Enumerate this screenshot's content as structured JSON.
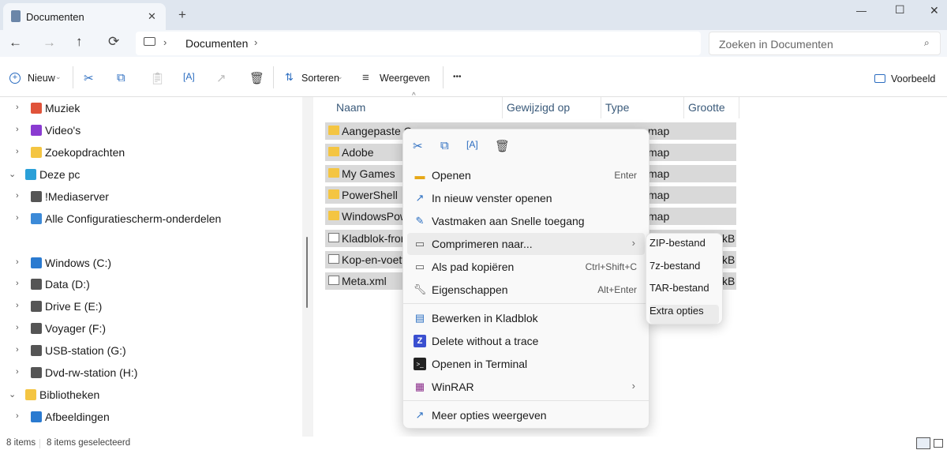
{
  "tab": {
    "title": "Documenten",
    "close": "✕",
    "new": "+"
  },
  "window": {
    "minimize": "—",
    "maximize": "☐",
    "close": "✕"
  },
  "nav": {
    "back": "←",
    "forward": "→",
    "up": "↑",
    "refresh": "⟳",
    "breadcrumb": [
      "Documenten"
    ],
    "search_placeholder": "Zoeken in Documenten"
  },
  "toolbar": {
    "new_label": "Nieuw",
    "sort_label": "Sorteren",
    "view_label": "Weergeven",
    "more": "•••",
    "preview_label": "Voorbeeld"
  },
  "sidebar": {
    "items": [
      {
        "label": "Muziek",
        "icon": "music-icon",
        "color": "#e0533a"
      },
      {
        "label": "Video's",
        "icon": "video-icon",
        "color": "#8a3bd1"
      },
      {
        "label": "Zoekopdrachten",
        "icon": "folder-icon",
        "color": "#f4c542"
      },
      {
        "label": "Deze pc",
        "icon": "monitor-icon",
        "color": "#2aa0d8"
      },
      {
        "label": "!Mediaserver",
        "icon": "network-drive-icon",
        "color": "#555"
      },
      {
        "label": "Alle Configuratiescherm-onderdelen",
        "icon": "control-panel-icon",
        "color": "#3c8ad8"
      },
      {
        "label": "Windows (C:)",
        "icon": "windows-drive-icon",
        "color": "#2a7ad0"
      },
      {
        "label": "Data (D:)",
        "icon": "drive-icon",
        "color": "#555"
      },
      {
        "label": "Drive E (E:)",
        "icon": "drive-icon",
        "color": "#555"
      },
      {
        "label": "Voyager (F:)",
        "icon": "drive-icon",
        "color": "#555"
      },
      {
        "label": "USB-station (G:)",
        "icon": "drive-icon",
        "color": "#555"
      },
      {
        "label": "Dvd-rw-station (H:)",
        "icon": "dvd-drive-icon",
        "color": "#555"
      },
      {
        "label": "Bibliotheken",
        "icon": "folder-icon",
        "color": "#f4c542"
      },
      {
        "label": "Afbeeldingen",
        "icon": "pictures-icon",
        "color": "#2a7ad0"
      }
    ]
  },
  "columns": {
    "name": "Naam",
    "modified": "Gewijzigd op",
    "type": "Type",
    "size": "Grootte"
  },
  "files": [
    {
      "name": "Aangepaste O",
      "type": "map",
      "size": "",
      "icon": "folder"
    },
    {
      "name": "Adobe",
      "type": "map",
      "size": "",
      "icon": "folder"
    },
    {
      "name": "My Games",
      "type": "map",
      "size": "",
      "icon": "folder"
    },
    {
      "name": "PowerShell",
      "type": "map",
      "size": "",
      "icon": "folder"
    },
    {
      "name": "WindowsPow",
      "type": "map",
      "size": "",
      "icon": "folder"
    },
    {
      "name": "Kladblok-fror",
      "type": "",
      "size": "kB",
      "icon": "doc"
    },
    {
      "name": "Kop-en-voett",
      "type": "",
      "size": "kB",
      "icon": "doc"
    },
    {
      "name": "Meta.xml",
      "type": "",
      "size": "kB",
      "icon": "file"
    }
  ],
  "context_menu": {
    "quick": [
      "cut-icon",
      "copy-icon",
      "rename-icon",
      "delete-icon"
    ],
    "items": [
      {
        "label": "Openen",
        "shortcut": "Enter",
        "icon": "open-folder-icon"
      },
      {
        "label": "In nieuw venster openen",
        "shortcut": "",
        "icon": "new-window-icon"
      },
      {
        "label": "Vastmaken aan Snelle toegang",
        "shortcut": "",
        "icon": "pin-icon"
      },
      {
        "label": "Comprimeren naar...",
        "shortcut": "",
        "icon": "zip-icon",
        "submenu": true
      },
      {
        "label": "Als pad kopiëren",
        "shortcut": "Ctrl+Shift+C",
        "icon": "copy-path-icon"
      },
      {
        "label": "Eigenschappen",
        "shortcut": "Alt+Enter",
        "icon": "wrench-icon"
      },
      {
        "label": "Bewerken in Kladblok",
        "shortcut": "",
        "icon": "notepad-icon"
      },
      {
        "label": "Delete without a trace",
        "shortcut": "",
        "icon": "shredder-icon"
      },
      {
        "label": "Openen in Terminal",
        "shortcut": "",
        "icon": "terminal-icon"
      },
      {
        "label": "WinRAR",
        "shortcut": "",
        "icon": "winrar-icon",
        "submenu": true
      },
      {
        "label": "Meer opties weergeven",
        "shortcut": "",
        "icon": "more-options-icon"
      }
    ],
    "arrow": "›"
  },
  "submenu": {
    "items": [
      "ZIP-bestand",
      "7z-bestand",
      "TAR-bestand",
      "Extra opties"
    ]
  },
  "status": {
    "count": "8 items",
    "selected": "8 items geselecteerd"
  }
}
